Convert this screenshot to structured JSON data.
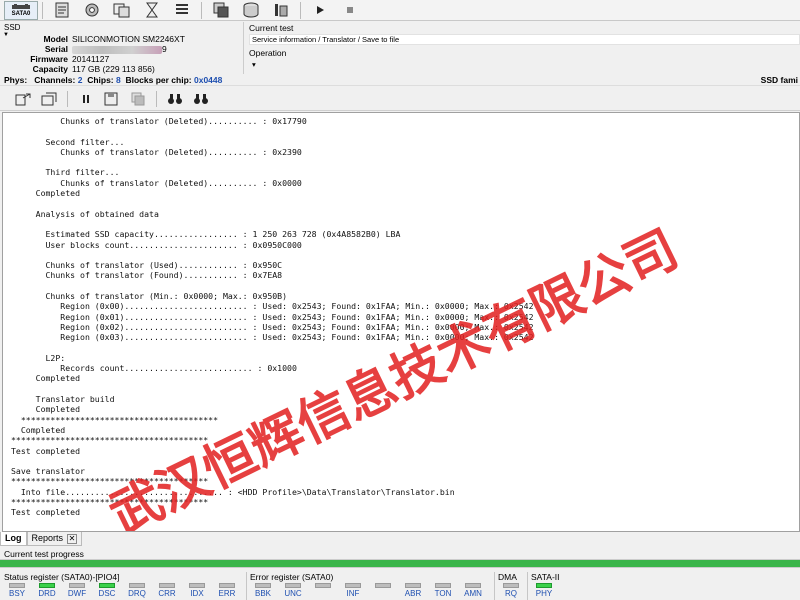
{
  "toolbar": {
    "sata_label": "SATA0",
    "buttons": [
      "disk-info-icon",
      "settings-gear-icon",
      "tasks-icon",
      "hourglass-icon",
      "list-icon",
      "copy-icon",
      "database-icon",
      "memory-icon",
      "play-icon",
      "stop-icon"
    ]
  },
  "device": {
    "section": "SSD",
    "model_label": "Model",
    "model": "SILICONMOTION SM2246XT",
    "serial_label": "Serial",
    "serial_suffix": "9",
    "firmware_label": "Firmware",
    "firmware": "20141127",
    "capacity_label": "Capacity",
    "capacity": "117 GB (229 113 856)"
  },
  "current_test": {
    "label": "Current test",
    "value": "Service information / Translator / Save to file",
    "operation_label": "Operation",
    "operation_value": ""
  },
  "phys": {
    "label": "Phys:",
    "channels_label": "Channels:",
    "channels": "2",
    "chips_label": "Chips:",
    "chips": "8",
    "blocks_label": "Blocks per chip:",
    "blocks": "0x0448",
    "right": "SSD fami"
  },
  "log_lines": [
    "          Chunks of translator (Deleted).......... : 0x17790",
    "",
    "       Second filter...",
    "          Chunks of translator (Deleted).......... : 0x2390",
    "",
    "       Third filter...",
    "          Chunks of translator (Deleted).......... : 0x0000",
    "     Completed",
    "",
    "     Analysis of obtained data",
    "",
    "       Estimated SSD capacity................. : 1 250 263 728 (0x4A8582B0) LBA",
    "       User blocks count...................... : 0x0950C000",
    "",
    "       Chunks of translator (Used)............ : 0x950C",
    "       Chunks of translator (Found)........... : 0x7EA8",
    "",
    "       Chunks of translator (Min.: 0x0000; Max.: 0x950B)",
    "          Region (0x00)......................... : Used: 0x2543; Found: 0x1FAA; Min.: 0x0000; Max.: 0x2542",
    "          Region (0x01)......................... : Used: 0x2543; Found: 0x1FAA; Min.: 0x0000; Max.: 0x2542",
    "          Region (0x02)......................... : Used: 0x2543; Found: 0x1FAA; Min.: 0x0000; Max.: 0x2542",
    "          Region (0x03)......................... : Used: 0x2543; Found: 0x1FAA; Min.: 0x0000; Max.: 0x2542",
    "",
    "       L2P:",
    "          Records count.......................... : 0x1000",
    "     Completed",
    "",
    "     Translator build",
    "     Completed",
    "  ****************************************",
    "  Completed",
    "****************************************",
    "Test completed",
    "",
    "Save translator",
    "****************************************",
    "  Into file................................ : <HDD Profile>\\Data\\Translator\\Translator.bin",
    "****************************************",
    "Test completed"
  ],
  "watermark": "武汉恒辉信息技术有限公司",
  "tabs": [
    {
      "label": "Log",
      "active": true
    },
    {
      "label": "Reports",
      "active": false
    }
  ],
  "progress": {
    "label": "Current test progress",
    "value": 1.0
  },
  "status_register": {
    "title": "Status register (SATA0)-[PIO4]",
    "bits": [
      {
        "name": "BSY",
        "on": false
      },
      {
        "name": "DRD",
        "on": true
      },
      {
        "name": "DWF",
        "on": false
      },
      {
        "name": "DSC",
        "on": true
      },
      {
        "name": "DRQ",
        "on": false
      },
      {
        "name": "CRR",
        "on": false
      },
      {
        "name": "IDX",
        "on": false
      },
      {
        "name": "ERR",
        "on": false
      }
    ]
  },
  "error_register": {
    "title": "Error register (SATA0)",
    "bits": [
      {
        "name": "BBK",
        "on": false
      },
      {
        "name": "UNC",
        "on": false
      },
      {
        "name": "",
        "on": false
      },
      {
        "name": "INF",
        "on": false
      },
      {
        "name": "",
        "on": false
      },
      {
        "name": "ABR",
        "on": false
      },
      {
        "name": "TON",
        "on": false
      },
      {
        "name": "AMN",
        "on": false
      }
    ]
  },
  "dma": {
    "title": "DMA",
    "bit": "RQ",
    "on": false
  },
  "sata2": {
    "title": "SATA-II",
    "bit": "PHY",
    "on": true
  },
  "colors": {
    "accent_blue": "#1e4fb0",
    "led_on": "#3bd14a",
    "watermark_red": "#e21f1f"
  }
}
